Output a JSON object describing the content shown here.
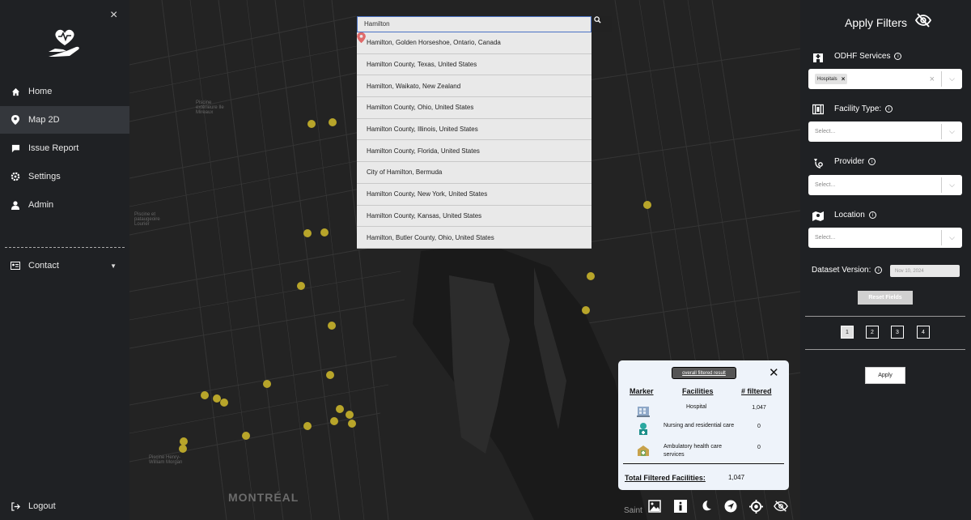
{
  "sidebar": {
    "close_label": "×",
    "items": [
      {
        "label": "Home",
        "icon": "home-icon"
      },
      {
        "label": "Map 2D",
        "icon": "map-pin-icon",
        "active": true
      },
      {
        "label": "Issue Report",
        "icon": "comment-icon"
      },
      {
        "label": "Settings",
        "icon": "gear-icon"
      },
      {
        "label": "Admin",
        "icon": "user-icon"
      }
    ],
    "contact_label": "Contact",
    "logout_label": "Logout"
  },
  "map": {
    "city_label": "MONTRÉAL",
    "saint_label": "Saint",
    "search": {
      "value": "Hamilton",
      "button_icon": "search-icon",
      "suggestions": [
        "Hamilton, Golden Horseshoe, Ontario, Canada",
        "Hamilton County, Texas, United States",
        "Hamilton, Waikato, New Zealand",
        "Hamilton County, Ohio, United States",
        "Hamilton County, Illinois, United States",
        "Hamilton County, Florida, United States",
        "City of Hamilton, Bermuda",
        "Hamilton County, New York, United States",
        "Hamilton County, Kansas, United States",
        "Hamilton, Butler County, Ohio, United States"
      ]
    },
    "marker_color": "#b8a52a"
  },
  "results": {
    "button_label": "overall filtered result",
    "close_label": "✕",
    "headers": {
      "marker": "Marker",
      "facilities": "Facilities",
      "filtered": "# filtered"
    },
    "rows": [
      {
        "facility": "Hospital",
        "count": "1,047"
      },
      {
        "facility": "Nursing and residential care",
        "count": "0"
      },
      {
        "facility": "Ambulatory health care services",
        "count": "0"
      }
    ],
    "total_label": "Total Filtered Facilities:",
    "total_value": "1,047"
  },
  "filters": {
    "title": "Apply Filters",
    "odhf_label": "ODHF Services",
    "odhf_chip": "Hospitals",
    "facility_type_label": "Facility Type:",
    "provider_label": "Provider",
    "location_label": "Location",
    "select_placeholder": "Select...",
    "dataset_label": "Dataset Version:",
    "dataset_value": "Nov 10, 2024",
    "reset_label": "Reset Fields",
    "pages": [
      "1",
      "2",
      "3",
      "4"
    ],
    "apply_label": "Apply"
  }
}
